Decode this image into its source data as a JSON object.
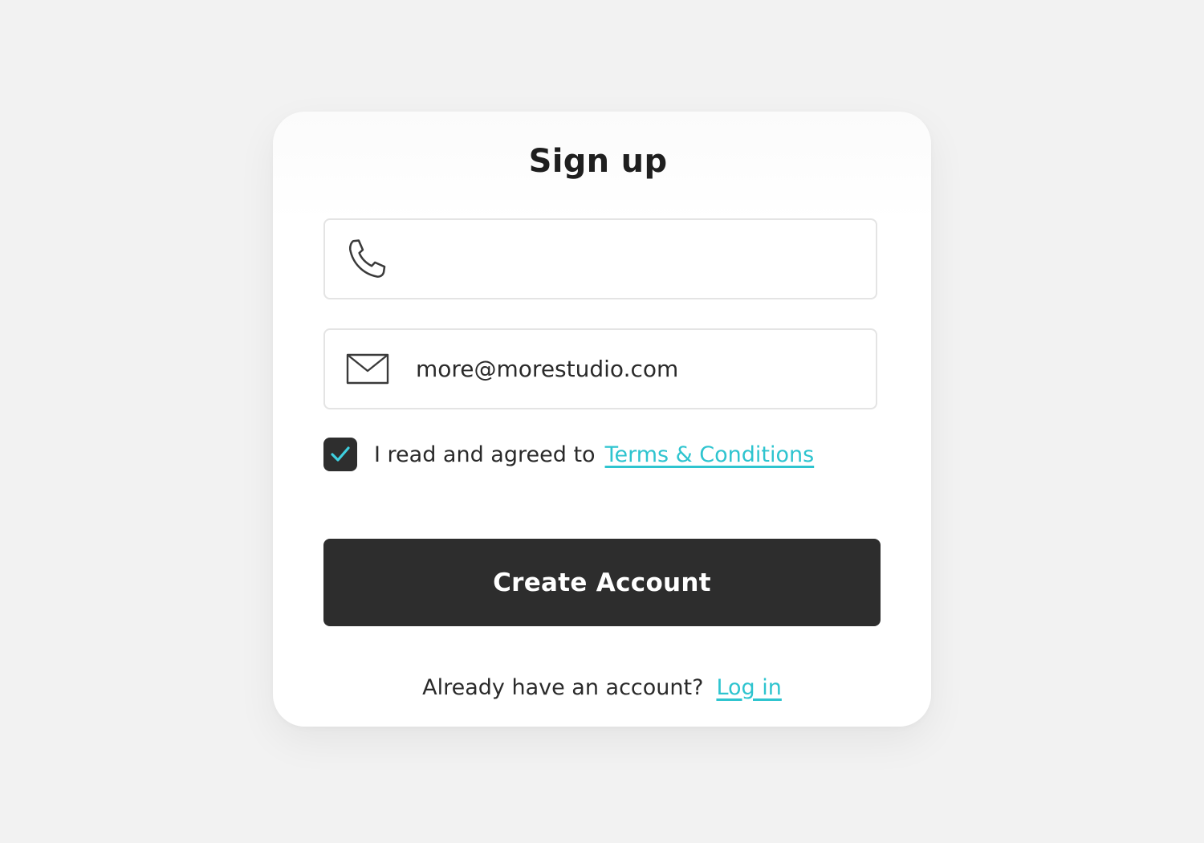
{
  "form": {
    "title": "Sign up",
    "phone_field": {
      "icon": "phone-icon",
      "value": "",
      "placeholder": ""
    },
    "email_field": {
      "icon": "envelope-icon",
      "value": "more@morestudio.com"
    },
    "terms": {
      "checked": true,
      "text": "I read and agreed to",
      "link_label": "Terms & Conditions"
    },
    "submit_label": "Create Account",
    "footer": {
      "text": "Already have an account?",
      "link_label": "Log in"
    }
  },
  "colors": {
    "background": "#f2f2f2",
    "card": "#ffffff",
    "accent": "#2ec4cf",
    "button": "#2d2d2d",
    "checkbox": "#2e2e2e",
    "checkmark": "#3fd0e0"
  }
}
